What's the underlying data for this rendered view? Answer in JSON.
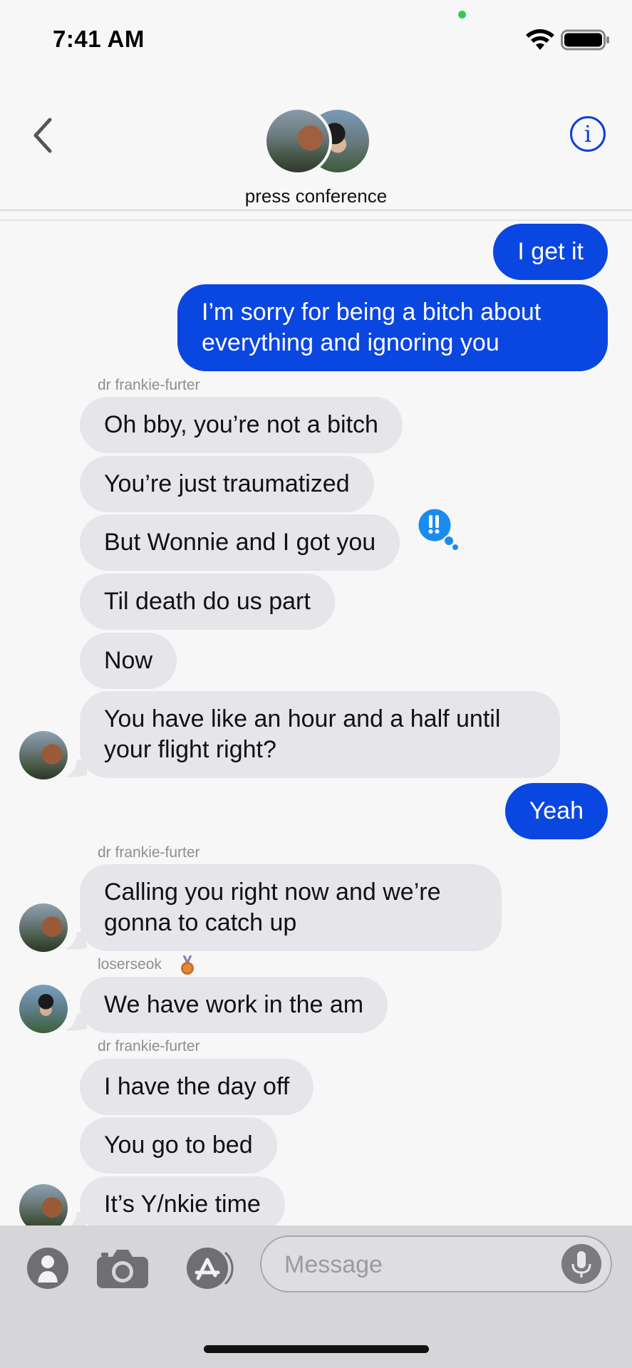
{
  "status": {
    "time": "7:41 AM"
  },
  "header": {
    "group_name": "press conference",
    "info_label": "i"
  },
  "messages": [
    {
      "text": "I get it"
    },
    {
      "text": "I’m sorry for being a bitch about everything and ignoring you"
    },
    {
      "sender": "dr frankie-furter"
    },
    {
      "text": "Oh bby, you’re not a bitch"
    },
    {
      "text": "You’re just traumatized"
    },
    {
      "text": "But Wonnie and I got you"
    },
    {
      "text": "Til death do us part"
    },
    {
      "text": "Now"
    },
    {
      "text": "You have like an hour and a half until your flight right?"
    },
    {
      "text": "Yeah"
    },
    {
      "sender": "dr frankie-furter"
    },
    {
      "text": "Calling you right now and we’re gonna to catch up"
    },
    {
      "sender": "loserseok"
    },
    {
      "text": "We have work in the am"
    },
    {
      "sender": "dr frankie-furter"
    },
    {
      "text": "I have the day off"
    },
    {
      "text": "You go to bed"
    },
    {
      "text": "It’s Y/nkie time"
    }
  ],
  "input": {
    "placeholder": "Message"
  },
  "colors": {
    "accent": "#0a46e0",
    "incoming": "#e5e5ea",
    "reaction": "#1a8cf0"
  },
  "icons": [
    "wifi-icon",
    "battery-icon",
    "back-chevron-icon",
    "info-icon",
    "emphasis-reaction-icon",
    "medal-icon",
    "contact-icon",
    "camera-icon",
    "appstore-icon",
    "mic-icon"
  ]
}
